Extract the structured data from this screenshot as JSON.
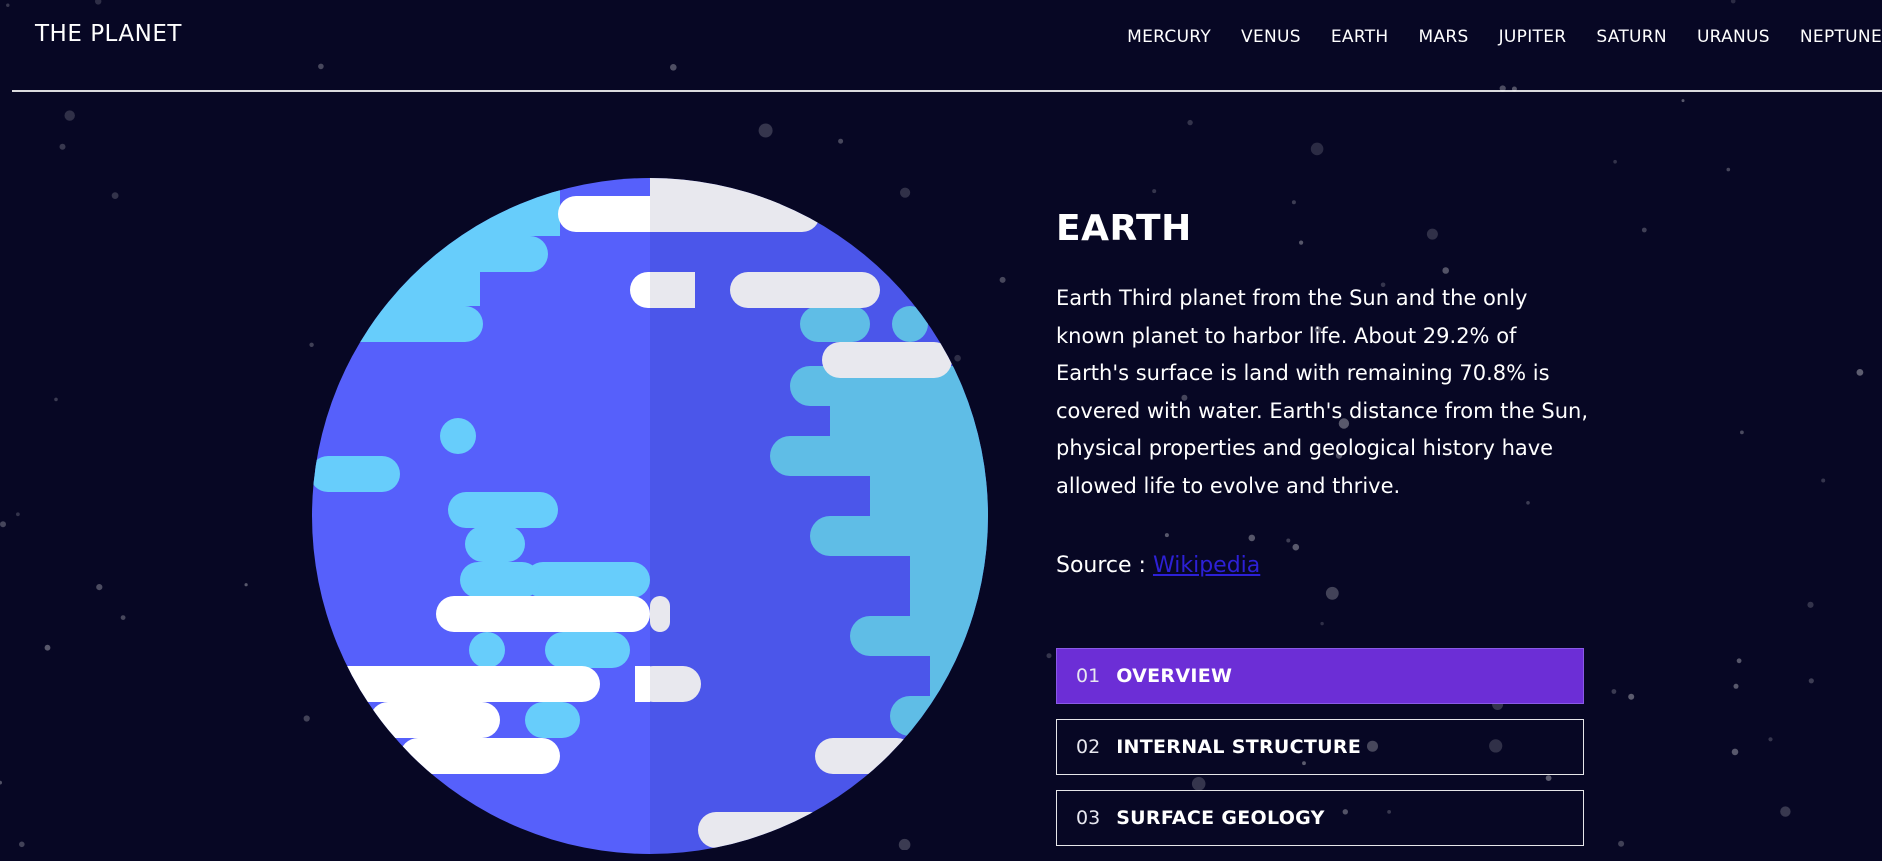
{
  "header": {
    "logo": "THE PLANET",
    "nav": [
      "MERCURY",
      "VENUS",
      "EARTH",
      "MARS",
      "JUPITER",
      "SATURN",
      "URANUS",
      "NEPTUNE"
    ]
  },
  "planet": {
    "name": "EARTH",
    "description": "Earth Third planet from the Sun and the only known planet to harbor life. About 29.2% of Earth's surface is land with remaining 70.8% is covered with water. Earth's distance from the Sun, physical properties and geological history have allowed life to evolve and thrive.",
    "source_label": "Source : ",
    "source_link": "Wikipedia"
  },
  "tabs": [
    {
      "num": "01",
      "label": "OVERVIEW",
      "active": true
    },
    {
      "num": "02",
      "label": "INTERNAL STRUCTURE",
      "active": false
    },
    {
      "num": "03",
      "label": "SURFACE GEOLOGY",
      "active": false
    }
  ],
  "colors": {
    "background": "#070724",
    "active_tab": "#6c2ed6",
    "ocean": "#5660fb",
    "ocean_shade": "#4b56ea",
    "land": "#67cdfb",
    "land_shade": "#5fbde6",
    "cloud": "#ffffff",
    "cloud_shade": "#e8e8ee"
  },
  "icons": [
    "earth-illustration"
  ]
}
